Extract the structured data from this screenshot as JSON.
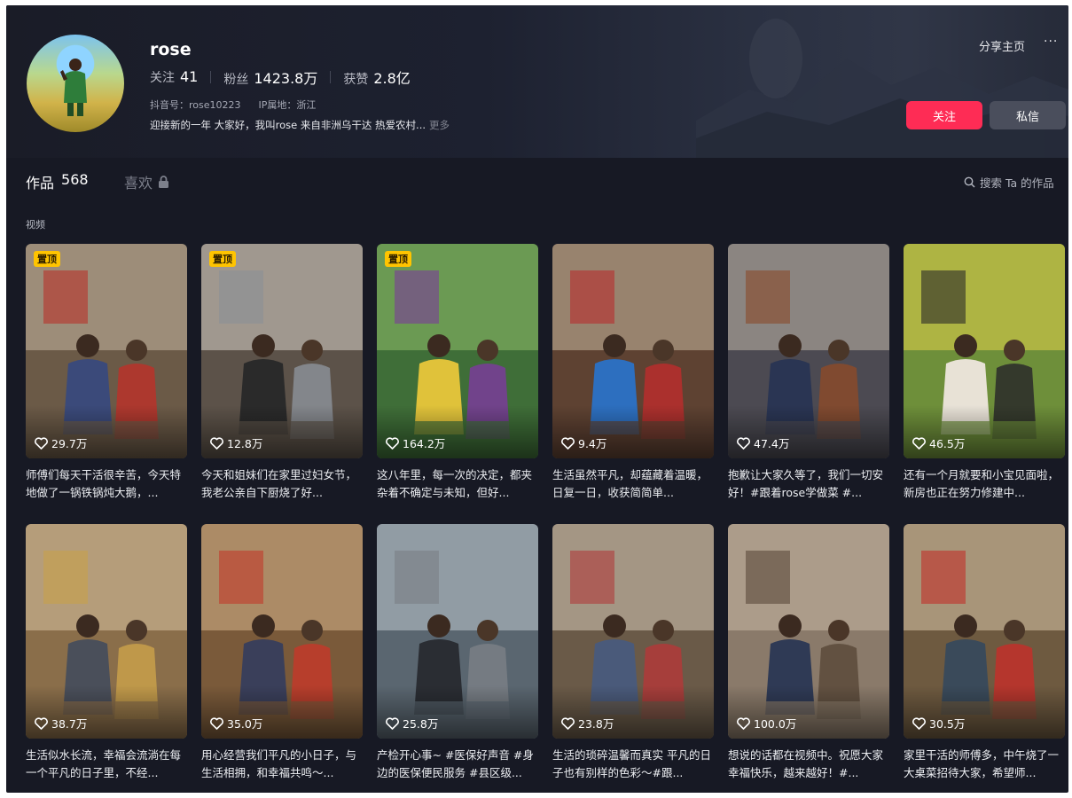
{
  "profile": {
    "name": "rose",
    "follow_label": "关注",
    "follow_count": "41",
    "fans_label": "粉丝",
    "fans_count": "1423.8万",
    "likes_label": "获赞",
    "likes_count": "2.8亿",
    "douyin_id": "抖音号：rose10223",
    "ip_location": "IP属地：浙江",
    "bio": "迎接新的一年 大家好，我叫rose 来自非洲乌干达 热爱农村...",
    "bio_more": "更多"
  },
  "actions": {
    "share_label": "分享主页",
    "more_label": "···",
    "follow_button": "关注",
    "message_button": "私信"
  },
  "tabs": {
    "works_label": "作品",
    "works_count": "568",
    "likes_label": "喜欢",
    "search_label": "搜索 Ta 的作品"
  },
  "section_label": "视频",
  "pinned_label": "置顶",
  "videos": [
    {
      "likes": "29.7万",
      "pinned": true,
      "caption": "师傅们每天干活很辛苦，今天特地做了一锅铁锅炖大鹅，..."
    },
    {
      "likes": "12.8万",
      "pinned": true,
      "caption": "今天和姐妹们在家里过妇女节，我老公亲自下厨烧了好..."
    },
    {
      "likes": "164.2万",
      "pinned": true,
      "caption": "这八年里，每一次的决定，都夹杂着不确定与未知，但好..."
    },
    {
      "likes": "9.4万",
      "pinned": false,
      "caption": "生活虽然平凡，却蕴藏着温暖，日复一日，收获简简单..."
    },
    {
      "likes": "47.4万",
      "pinned": false,
      "caption": "抱歉让大家久等了，我们一切安好！#跟着rose学做菜 #..."
    },
    {
      "likes": "46.5万",
      "pinned": false,
      "caption": "还有一个月就要和小宝见面啦，新房也正在努力修建中..."
    },
    {
      "likes": "38.7万",
      "pinned": false,
      "caption": "生活似水长流，幸福会流淌在每一个平凡的日子里，不经..."
    },
    {
      "likes": "35.0万",
      "pinned": false,
      "caption": "用心经营我们平凡的小日子，与生活相拥，和幸福共鸣～..."
    },
    {
      "likes": "25.8万",
      "pinned": false,
      "caption": "产检开心事~ #医保好声音 #身边的医保便民服务 #县区级..."
    },
    {
      "likes": "23.8万",
      "pinned": false,
      "caption": "生活的琐碎温馨而真实 平凡的日子也有别样的色彩～#跟..."
    },
    {
      "likes": "100.0万",
      "pinned": false,
      "caption": "想说的话都在视频中。祝愿大家幸福快乐，越来越好！#..."
    },
    {
      "likes": "30.5万",
      "pinned": false,
      "caption": "家里干活的师傅多，中午烧了一大桌菜招待大家，希望师..."
    }
  ],
  "colors": {
    "background": "#171924",
    "accent": "#fe2c55",
    "pin_badge": "#ffc400"
  }
}
